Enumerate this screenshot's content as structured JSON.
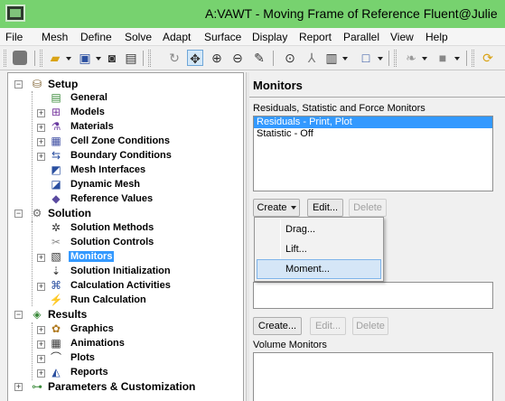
{
  "window": {
    "title": "A:VAWT - Moving Frame of Reference Fluent@Julie"
  },
  "menu": [
    "File",
    "Mesh",
    "Define",
    "Solve",
    "Adapt",
    "Surface",
    "Display",
    "Report",
    "Parallel",
    "View",
    "Help"
  ],
  "toolbar_icons": [
    "grip",
    "stop-icon",
    "open-folder-icon",
    "save-icon",
    "camera-icon",
    "print-icon",
    "rotate-icon",
    "pan-icon",
    "zoom-in-icon",
    "zoom-fit-icon",
    "probe-icon",
    "zoom-box-icon",
    "axes-icon",
    "layout-icon",
    "view-icon",
    "mouse-icon",
    "color-icon",
    "refresh-icon"
  ],
  "tree": {
    "setup": {
      "label": "Setup",
      "children": [
        "General",
        "Models",
        "Materials",
        "Cell Zone Conditions",
        "Boundary Conditions",
        "Mesh Interfaces",
        "Dynamic Mesh",
        "Reference Values"
      ]
    },
    "solution": {
      "label": "Solution",
      "children": [
        "Solution Methods",
        "Solution Controls",
        "Monitors",
        "Solution Initialization",
        "Calculation Activities",
        "Run Calculation"
      ]
    },
    "results": {
      "label": "Results",
      "children": [
        "Graphics",
        "Animations",
        "Plots",
        "Reports"
      ]
    },
    "params": {
      "label": "Parameters & Customization"
    }
  },
  "monitors": {
    "title": "Monitors",
    "residuals_label": "Residuals, Statistic and Force Monitors",
    "residual_items": [
      "Residuals - Print, Plot",
      "Statistic - Off"
    ],
    "create_label": "Create",
    "edit_label": "Edit...",
    "delete_label": "Delete",
    "create2_label": "Create...",
    "edit2_label": "Edit...",
    "delete2_label": "Delete",
    "volume_label": "Volume Monitors"
  },
  "popup": [
    "Drag...",
    "Lift...",
    "Moment..."
  ],
  "colors": {
    "title_bar": "#77d26f",
    "selection": "#3399ff",
    "menu_hover": "#d5e6f7"
  }
}
